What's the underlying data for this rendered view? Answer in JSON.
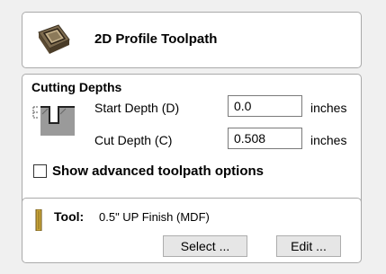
{
  "header": {
    "title": "2D Profile Toolpath",
    "icon": "profile-toolpath-icon"
  },
  "cutting_depths": {
    "section_title": "Cutting Depths",
    "start_depth": {
      "label": "Start Depth (D)",
      "value": "0.0",
      "unit": "inches"
    },
    "cut_depth": {
      "label": "Cut Depth (C)",
      "value": "0.508",
      "unit": "inches"
    },
    "advanced_option": {
      "label": "Show advanced toolpath options",
      "checked": false
    }
  },
  "tool": {
    "label": "Tool:",
    "value": "0.5\" UP Finish (MDF)",
    "select_label": "Select ...",
    "edit_label": "Edit ...",
    "icon": "end-mill-icon"
  },
  "colors": {
    "panel_border": "#aaaaaa",
    "background": "#f0f0f0",
    "tool_icon": "#c8a53a"
  }
}
